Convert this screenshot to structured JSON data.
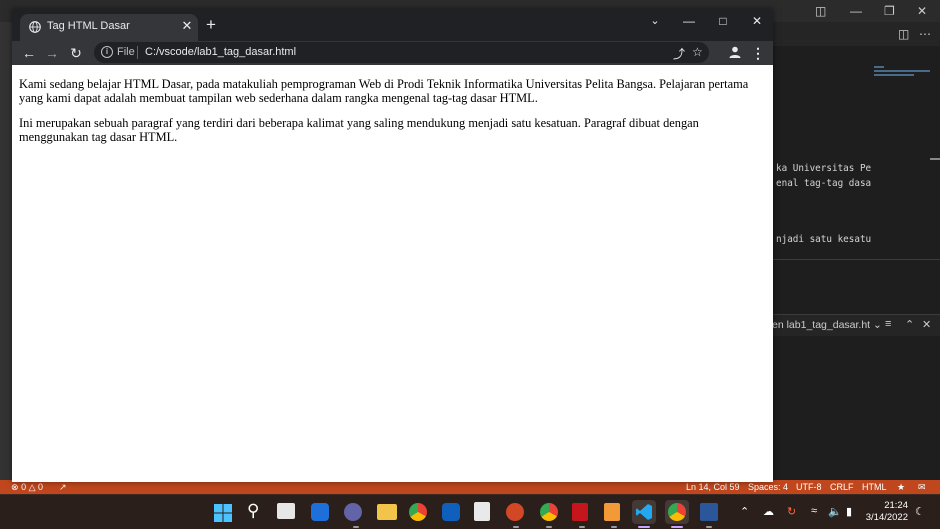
{
  "browser": {
    "tab_title": "Tag HTML Dasar",
    "url_scheme": "File",
    "url": "C:/vscode/lab1_tag_dasar.html"
  },
  "page": {
    "paragraphs": [
      "Kami sedang belajar HTML Dasar, pada matakuliah pemprograman Web di Prodi Teknik Informatika Universitas Pelita Bangsa. Pelajaran pertama yang kami dapat adalah membuat tampilan web sederhana dalam rangka mengenal tag-tag dasar HTML.",
      "Ini merupakan sebuah paragraf yang terdiri dari beberapa kalimat yang saling mendukung menjadi satu kesatuan. Paragraf dibuat dengan menggunakan tag dasar HTML."
    ]
  },
  "vscode": {
    "code_lines": [
      "ka Universitas Pe",
      "enal tag-tag dasa",
      "njadi satu kesatu"
    ],
    "panel_title": "en lab1_tag_dasar.ht",
    "status": {
      "errors": "0",
      "warnings": "0",
      "position": "Ln 14, Col 59",
      "spaces": "Spaces: 4",
      "encoding": "UTF-8",
      "eol": "CRLF",
      "language": "HTML"
    }
  },
  "taskbar": {
    "time": "21:24",
    "date": "3/14/2022"
  },
  "colors": {
    "status_bar": "#c0471d",
    "chrome_frame": "#202124",
    "chrome_toolbar": "#35363a",
    "taskbar": "#2a1f1a"
  }
}
